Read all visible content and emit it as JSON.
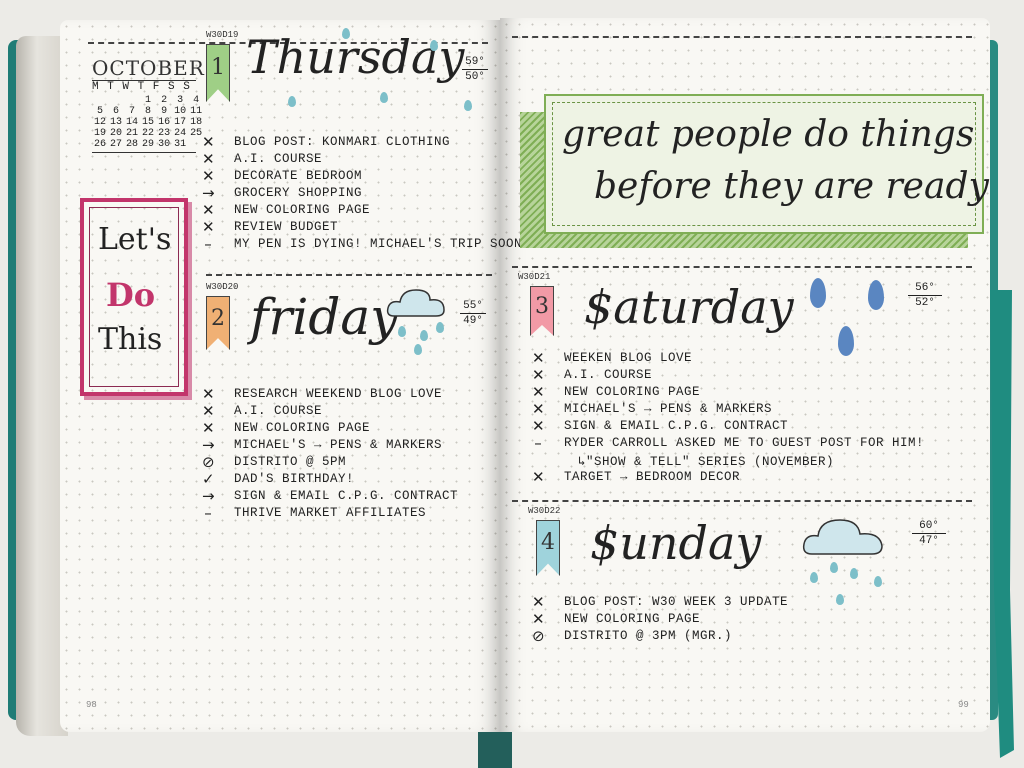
{
  "calendar": {
    "month": "OCTOBER",
    "weekdays": "M T W T F S S",
    "weeks": [
      [
        "",
        "",
        "",
        "1",
        "2",
        "3",
        "4"
      ],
      [
        "5",
        "6",
        "7",
        "8",
        "9",
        "10",
        "11"
      ],
      [
        "12",
        "13",
        "14",
        "15",
        "16",
        "17",
        "18"
      ],
      [
        "19",
        "20",
        "21",
        "22",
        "23",
        "24",
        "25"
      ],
      [
        "26",
        "27",
        "28",
        "29",
        "30",
        "31",
        ""
      ]
    ]
  },
  "motto": {
    "line1": "Let's",
    "line2": "Do",
    "line3": "This"
  },
  "days": {
    "thursday": {
      "code": "W30D19",
      "number": "1",
      "title": "Thursday",
      "temp_high": "59°",
      "temp_low": "50°",
      "tasks": [
        "BLOG POST: KONMARI CLOTHING",
        "A.I. COURSE",
        "DECORATE BEDROOM",
        "GROCERY SHOPPING",
        "NEW COLORING PAGE",
        "REVIEW BUDGET",
        "MY PEN IS DYING! MICHAEL'S TRIP SOON!"
      ]
    },
    "friday": {
      "code": "W30D20",
      "number": "2",
      "title": "friday",
      "temp_high": "55°",
      "temp_low": "49°",
      "tasks": [
        "RESEARCH WEEKEND BLOG LOVE",
        "A.I. COURSE",
        "NEW COLORING PAGE",
        "MICHAEL'S → PENS & MARKERS",
        "DISTRITO @ 5PM",
        "DAD'S BIRTHDAY!",
        "SIGN & EMAIL C.P.G. CONTRACT",
        "THRIVE MARKET AFFILIATES"
      ]
    },
    "saturday": {
      "code": "W30D21",
      "number": "3",
      "title": "$aturday",
      "temp_high": "56°",
      "temp_low": "52°",
      "tasks": [
        "WEEKEN BLOG LOVE",
        "A.I. COURSE",
        "NEW COLORING PAGE",
        "MICHAEL'S → PENS & MARKERS",
        "SIGN & EMAIL C.P.G. CONTRACT",
        "RYDER CARROLL ASKED ME TO GUEST POST FOR HIM!",
        "↳\"SHOW & TELL\" SERIES (NOVEMBER)",
        "TARGET → BEDROOM DECOR"
      ]
    },
    "sunday": {
      "code": "W30D22",
      "number": "4",
      "title": "$unday",
      "temp_high": "60°",
      "temp_low": "47°",
      "tasks": [
        "BLOG POST: W30 WEEK 3 UPDATE",
        "NEW COLORING PAGE",
        "DISTRITO @ 3PM (MGR.)"
      ]
    }
  },
  "quote": {
    "line1": "great people do things",
    "line2": "before they are ready"
  },
  "page_numbers": {
    "left": "98",
    "right": "99"
  },
  "colors": {
    "pink": "#c2356b",
    "green": "#9fcf86",
    "orange": "#f0b074",
    "blue": "#9fd3dc",
    "red": "#f29aa6",
    "teal": "#1f7c76",
    "quote_green": "#7fae55"
  },
  "icons": [
    "cloud-icon",
    "raindrop-icon",
    "x-bullet-icon",
    "arrow-bullet-icon",
    "check-bullet-icon",
    "dash-bullet-icon"
  ]
}
